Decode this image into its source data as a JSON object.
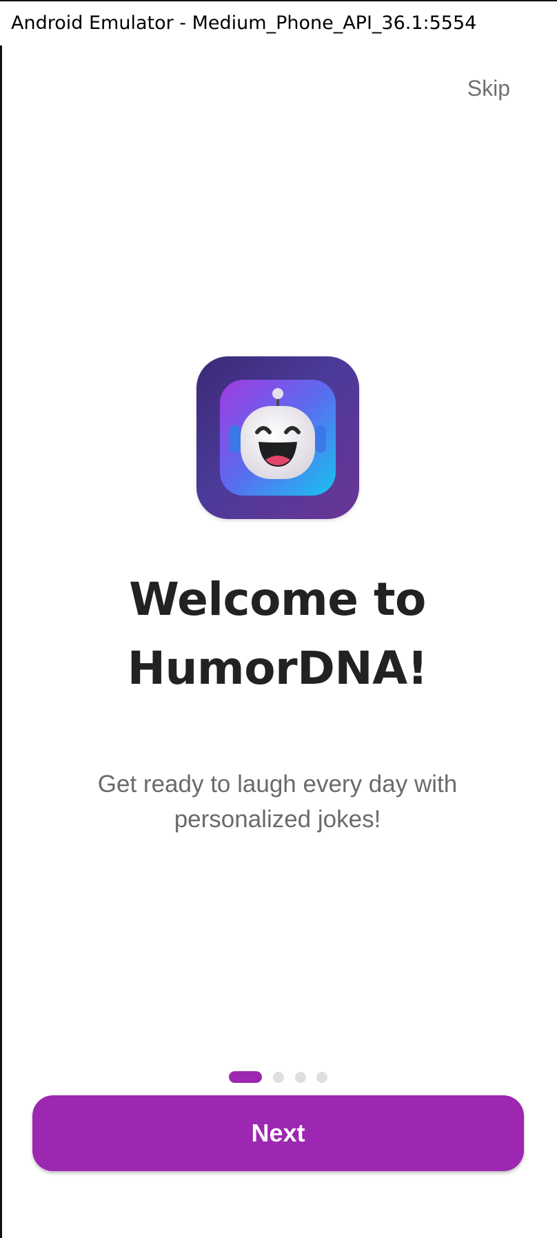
{
  "window": {
    "title": "Android Emulator - Medium_Phone_API_36.1:5554"
  },
  "onboarding": {
    "skip_label": "Skip",
    "icon": "happy-robot-icon",
    "title_line1": "Welcome to",
    "title_line2": "HumorDNA!",
    "subtitle": "Get ready to laugh every day with personalized jokes!",
    "page_indicator": {
      "total": 4,
      "current": 1
    },
    "next_label": "Next"
  },
  "colors": {
    "accent": "#9c27b0",
    "title": "#222222",
    "subtitle": "#6a6a6a",
    "skip": "#707070",
    "dot_inactive": "#dedede"
  }
}
